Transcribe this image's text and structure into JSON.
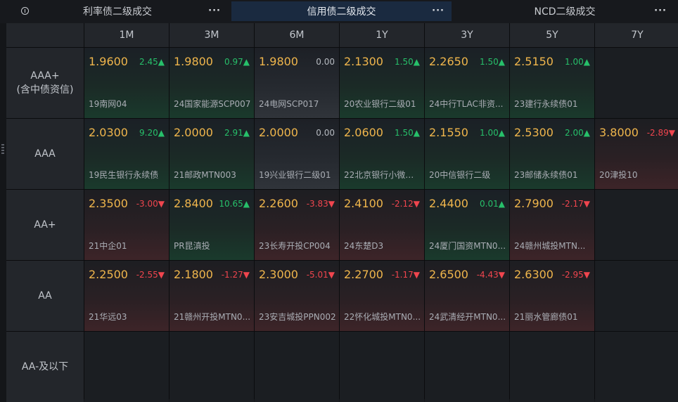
{
  "tabs": [
    {
      "label": "利率债二级成交",
      "more": "···"
    },
    {
      "label": "信用债二级成交",
      "more": "···"
    },
    {
      "label": "NCD二级成交",
      "more": "···"
    }
  ],
  "columns": [
    "1M",
    "3M",
    "6M",
    "1Y",
    "3Y",
    "5Y",
    "7Y"
  ],
  "rows": [
    {
      "label_line1": "AAA+",
      "label_line2": "(含中债资信)"
    },
    {
      "label_line1": "AAA",
      "label_line2": ""
    },
    {
      "label_line1": "AA+",
      "label_line2": ""
    },
    {
      "label_line1": "AA",
      "label_line2": ""
    },
    {
      "label_line1": "AA-及以下",
      "label_line2": ""
    }
  ],
  "cells": [
    [
      {
        "price": "1.9600",
        "change": "2.45▲",
        "dir": "up",
        "bond": "19南网04"
      },
      {
        "price": "1.9800",
        "change": "0.97▲",
        "dir": "up",
        "bond": "24国家能源SCP007"
      },
      {
        "price": "1.9800",
        "change": "0.00",
        "dir": "flat",
        "bond": "24电网SCP017"
      },
      {
        "price": "2.1300",
        "change": "1.50▲",
        "dir": "up",
        "bond": "20农业银行二级01"
      },
      {
        "price": "2.2650",
        "change": "1.50▲",
        "dir": "up",
        "bond": "24中行TLAC非资..."
      },
      {
        "price": "2.5150",
        "change": "1.00▲",
        "dir": "up",
        "bond": "23建行永续债01"
      },
      null
    ],
    [
      {
        "price": "2.0300",
        "change": "9.20▲",
        "dir": "up",
        "bond": "19民生银行永续债"
      },
      {
        "price": "2.0000",
        "change": "2.91▲",
        "dir": "up",
        "bond": "21邮政MTN003"
      },
      {
        "price": "2.0000",
        "change": "0.00",
        "dir": "flat",
        "bond": "19兴业银行二级01"
      },
      {
        "price": "2.0600",
        "change": "1.50▲",
        "dir": "up",
        "bond": "22北京银行小微债..."
      },
      {
        "price": "2.1550",
        "change": "1.00▲",
        "dir": "up",
        "bond": "20中信银行二级"
      },
      {
        "price": "2.5300",
        "change": "2.00▲",
        "dir": "up",
        "bond": "23邮储永续债01"
      },
      {
        "price": "3.8000",
        "change": "-2.89▼",
        "dir": "down",
        "bond": "20津投10"
      }
    ],
    [
      {
        "price": "2.3500",
        "change": "-3.00▼",
        "dir": "down",
        "bond": "21中企01"
      },
      {
        "price": "2.8400",
        "change": "10.65▲",
        "dir": "up",
        "bond": "PR昆滇投"
      },
      {
        "price": "2.2600",
        "change": "-3.83▼",
        "dir": "down",
        "bond": "23长寿开投CP004"
      },
      {
        "price": "2.4100",
        "change": "-2.12▼",
        "dir": "down",
        "bond": "24东楚D3"
      },
      {
        "price": "2.4400",
        "change": "0.01▲",
        "dir": "up",
        "bond": "24厦门国资MTN0..."
      },
      {
        "price": "2.7900",
        "change": "-2.17▼",
        "dir": "down",
        "bond": "24赣州城投MTN..."
      },
      null
    ],
    [
      {
        "price": "2.2500",
        "change": "-2.55▼",
        "dir": "down",
        "bond": "21华远03"
      },
      {
        "price": "2.1800",
        "change": "-1.27▼",
        "dir": "down",
        "bond": "21赣州开投MTN0..."
      },
      {
        "price": "2.3000",
        "change": "-5.01▼",
        "dir": "down",
        "bond": "23安吉城投PPN002"
      },
      {
        "price": "2.2700",
        "change": "-1.17▼",
        "dir": "down",
        "bond": "22怀化城投MTN0..."
      },
      {
        "price": "2.6500",
        "change": "-4.43▼",
        "dir": "down",
        "bond": "24武清经开MTN0..."
      },
      {
        "price": "2.6300",
        "change": "-2.95▼",
        "dir": "down",
        "bond": "21丽水管廊债01"
      },
      null
    ],
    [
      null,
      null,
      null,
      null,
      null,
      null,
      null
    ]
  ],
  "colors": {
    "price": "#f0b64c",
    "up": "#27c06a",
    "down": "#f0454e",
    "flat": "#b6bac0"
  },
  "icons": {
    "tab_info": "info-circle-icon",
    "tab_more": "more-dots-icon"
  }
}
